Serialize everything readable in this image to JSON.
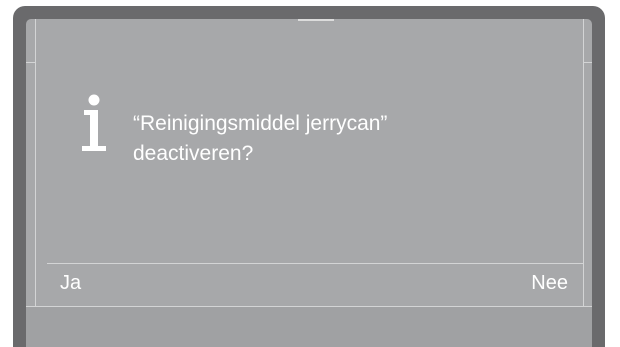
{
  "dialog": {
    "icon": "info-icon",
    "message_line1": "“Reinigingsmiddel jerrycan”",
    "message_line2": "deactiveren?"
  },
  "softkeys": {
    "left_label": "Ja",
    "right_label": "Nee"
  },
  "colors": {
    "frame": "#6a6a6c",
    "screen": "#a7a8aa",
    "text": "#ffffff",
    "lines": "#d3d4d5"
  }
}
